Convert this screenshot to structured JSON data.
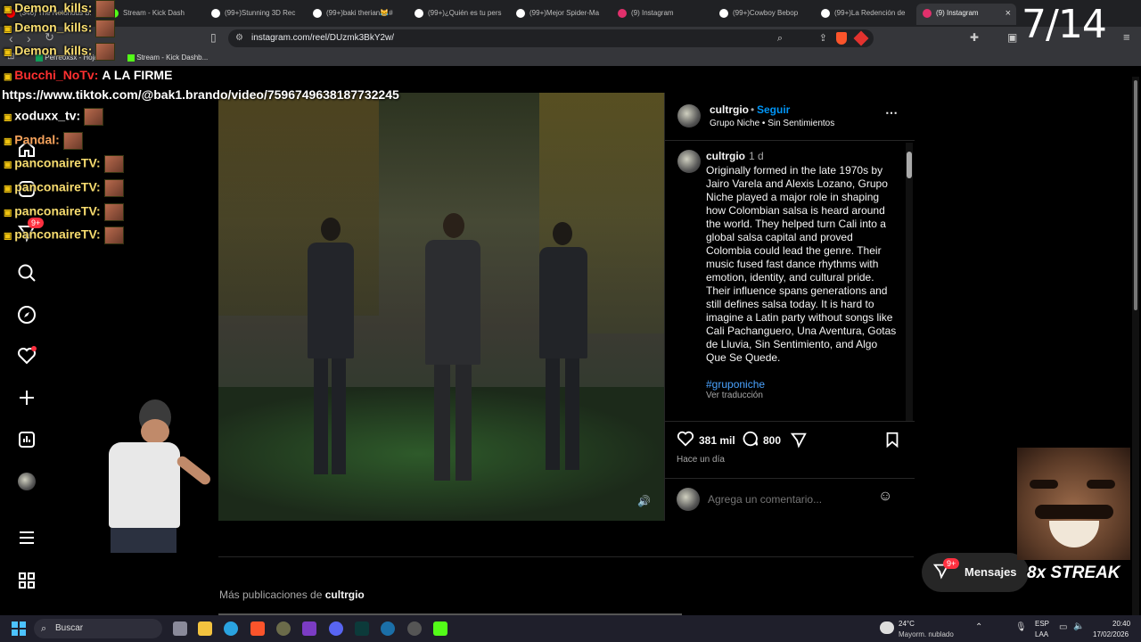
{
  "browser": {
    "tabs": [
      {
        "label": "(346) The Notorious B.",
        "icon_color": "#ff0000"
      },
      {
        "label": "Stream - Kick Dash",
        "icon_color": "#53fc18"
      },
      {
        "label": "(99+)Stunning 3D Rec",
        "icon_color": "#ffffff"
      },
      {
        "label": "(99+)baki therian😹#",
        "icon_color": "#ffffff"
      },
      {
        "label": "(99+)¿Quién es tu pers",
        "icon_color": "#ffffff"
      },
      {
        "label": "(99+)Mejor Spider-Ma",
        "icon_color": "#ffffff"
      },
      {
        "label": "(9) Instagram",
        "icon_color": "#e1306c"
      },
      {
        "label": "(99+)Cowboy Bebop",
        "icon_color": "#ffffff"
      },
      {
        "label": "(99+)La Redención de",
        "icon_color": "#ffffff"
      },
      {
        "label": "(9) Instagram",
        "icon_color": "#e1306c"
      }
    ],
    "url": "instagram.com/reel/DUzmk3BkY2w/",
    "bookmarks": [
      "Perreoxsx - Hojas",
      "Stream - Kick Dashb..."
    ]
  },
  "overlay": {
    "counter": "7/14",
    "chat": [
      {
        "user": "Demon_kills:",
        "text": "",
        "user_color": "#f7dc6f"
      },
      {
        "user": "Demon_kills:",
        "text": "",
        "user_color": "#f7dc6f"
      },
      {
        "user": "Demon_kills:",
        "text": "",
        "user_color": "#f7dc6f"
      },
      {
        "user": "Bucchi_NoTv:",
        "text": "A LA FIRME",
        "user_color": "#ff3030"
      },
      {
        "user": "",
        "text": "https://www.tiktok.com/@bak1.brando/video/7596749638187732245",
        "user_color": "#ffffff"
      },
      {
        "user": "xoduxx_tv:",
        "text": "",
        "user_color": "#ffffff"
      },
      {
        "user": "Pandal:",
        "text": "",
        "user_color": "#f7a35c"
      },
      {
        "user": "panconaireTV:",
        "text": "",
        "user_color": "#f7dc6f"
      },
      {
        "user": "panconaireTV:",
        "text": "",
        "user_color": "#f7dc6f"
      },
      {
        "user": "panconaireTV:",
        "text": "",
        "user_color": "#f7dc6f"
      },
      {
        "user": "panconaireTV:",
        "text": "",
        "user_color": "#f7dc6f"
      }
    ],
    "streak": "8x STREAK",
    "notif_badge": "9+"
  },
  "post": {
    "author": "cultrgio",
    "follow": "Seguir",
    "audio": "Grupo Niche • Sin Sentimientos",
    "caption_time": "1 d",
    "caption": "Originally formed in the late 1970s by Jairo Varela and Alexis Lozano, Grupo Niche played a major role in shaping how Colombian salsa is heard around the world. They helped turn Cali into a global salsa capital and proved Colombia could lead the genre. Their music fused fast dance rhythms with emotion, identity, and cultural pride. Their influence spans generations and still defines salsa today. It is hard to imagine a Latin party without songs like Cali Pachanguero, Una Aventura, Gotas de Lluvia, Sin Sentimiento, and Algo Que Se Quede.",
    "hashtag": "#gruponiche",
    "translate": "Ver traducción",
    "likes": "381 mil",
    "comments": "800",
    "posted": "Hace un día",
    "comment_placeholder": "Agrega un comentario...",
    "more_from_prefix": "Más publicaciones de",
    "more_from_user": "cultrgio"
  },
  "messages": {
    "label": "Mensajes",
    "badge": "9+"
  },
  "taskbar": {
    "search": "Buscar",
    "weather_temp": "24°C",
    "weather_desc": "Mayorm. nublado",
    "lang1": "ESP",
    "lang2": "LAA",
    "time": "20:40",
    "date": "17/02/2026"
  }
}
